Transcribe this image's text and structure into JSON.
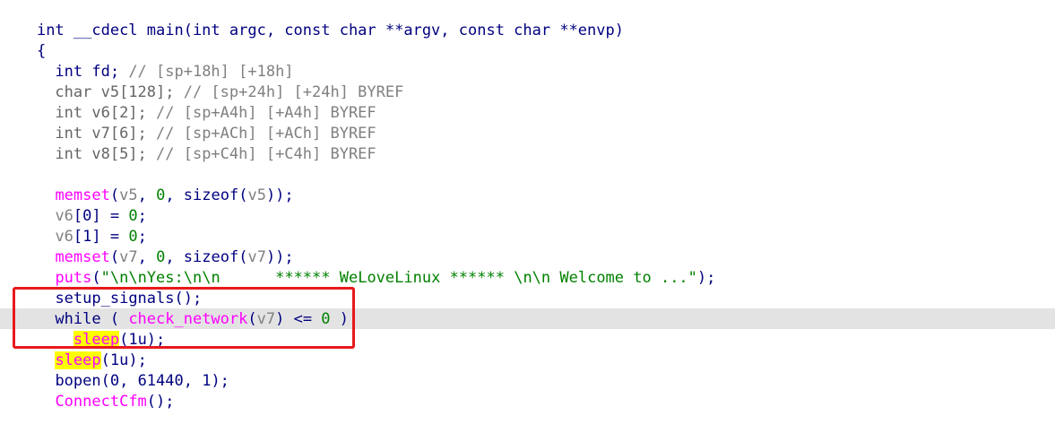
{
  "colors": {
    "keyword": "#000080",
    "function": "#ff00ff",
    "variable": "#808080",
    "number": "#008000",
    "comment": "#808080",
    "string": "#008000",
    "highlight_word": "#ffff00",
    "highlight_row": "#e3e3e3",
    "annotation_box": "#e8191b"
  },
  "lines": [
    {
      "parts": [
        "int __cdecl main(int argc, const char **argv, const char **envp)"
      ]
    },
    {
      "parts": [
        "{"
      ]
    },
    {
      "parts": [
        "  int fd; ",
        "// [sp+18h] [+18h]"
      ]
    },
    {
      "parts": [
        "  char v5[128]; ",
        "// [sp+24h] [+24h] BYREF"
      ]
    },
    {
      "parts": [
        "  int v6[2]; ",
        "// [sp+A4h] [+A4h] BYREF"
      ]
    },
    {
      "parts": [
        "  int v7[6]; ",
        "// [sp+ACh] [+ACh] BYREF"
      ]
    },
    {
      "parts": [
        "  int v8[5]; ",
        "// [sp+C4h] [+C4h] BYREF"
      ]
    },
    {
      "parts": [
        ""
      ]
    },
    {
      "parts": [
        "  ",
        "memset",
        "(",
        "v5",
        ", ",
        "0",
        ", sizeof(",
        "v5",
        "));"
      ]
    },
    {
      "parts": [
        "  ",
        "v6",
        "[0] = ",
        "0",
        ";"
      ]
    },
    {
      "parts": [
        "  ",
        "v6",
        "[1] = ",
        "0",
        ";"
      ]
    },
    {
      "parts": [
        "  ",
        "memset",
        "(",
        "v7",
        ", ",
        "0",
        ", sizeof(",
        "v7",
        "));"
      ]
    },
    {
      "parts": [
        "  ",
        "puts",
        "(",
        "\"\\n\\nYes:\\n\\n      ****** WeLoveLinux ****** \\n\\n Welcome to ...\"",
        ");"
      ]
    },
    {
      "parts": [
        "  ",
        "setup_signals",
        "();"
      ]
    },
    {
      "parts": [
        "  while ( ",
        "check_network",
        "(",
        "v7",
        ") <= ",
        "0",
        " )"
      ]
    },
    {
      "parts": [
        "    ",
        "sleep",
        "(1u);"
      ]
    },
    {
      "parts": [
        "  ",
        "sleep",
        "(1u);"
      ]
    },
    {
      "parts": [
        "  ",
        "bopen",
        "(0, 61440, 1);"
      ]
    },
    {
      "parts": [
        "  ",
        "ConnectCfm",
        "();"
      ]
    }
  ]
}
